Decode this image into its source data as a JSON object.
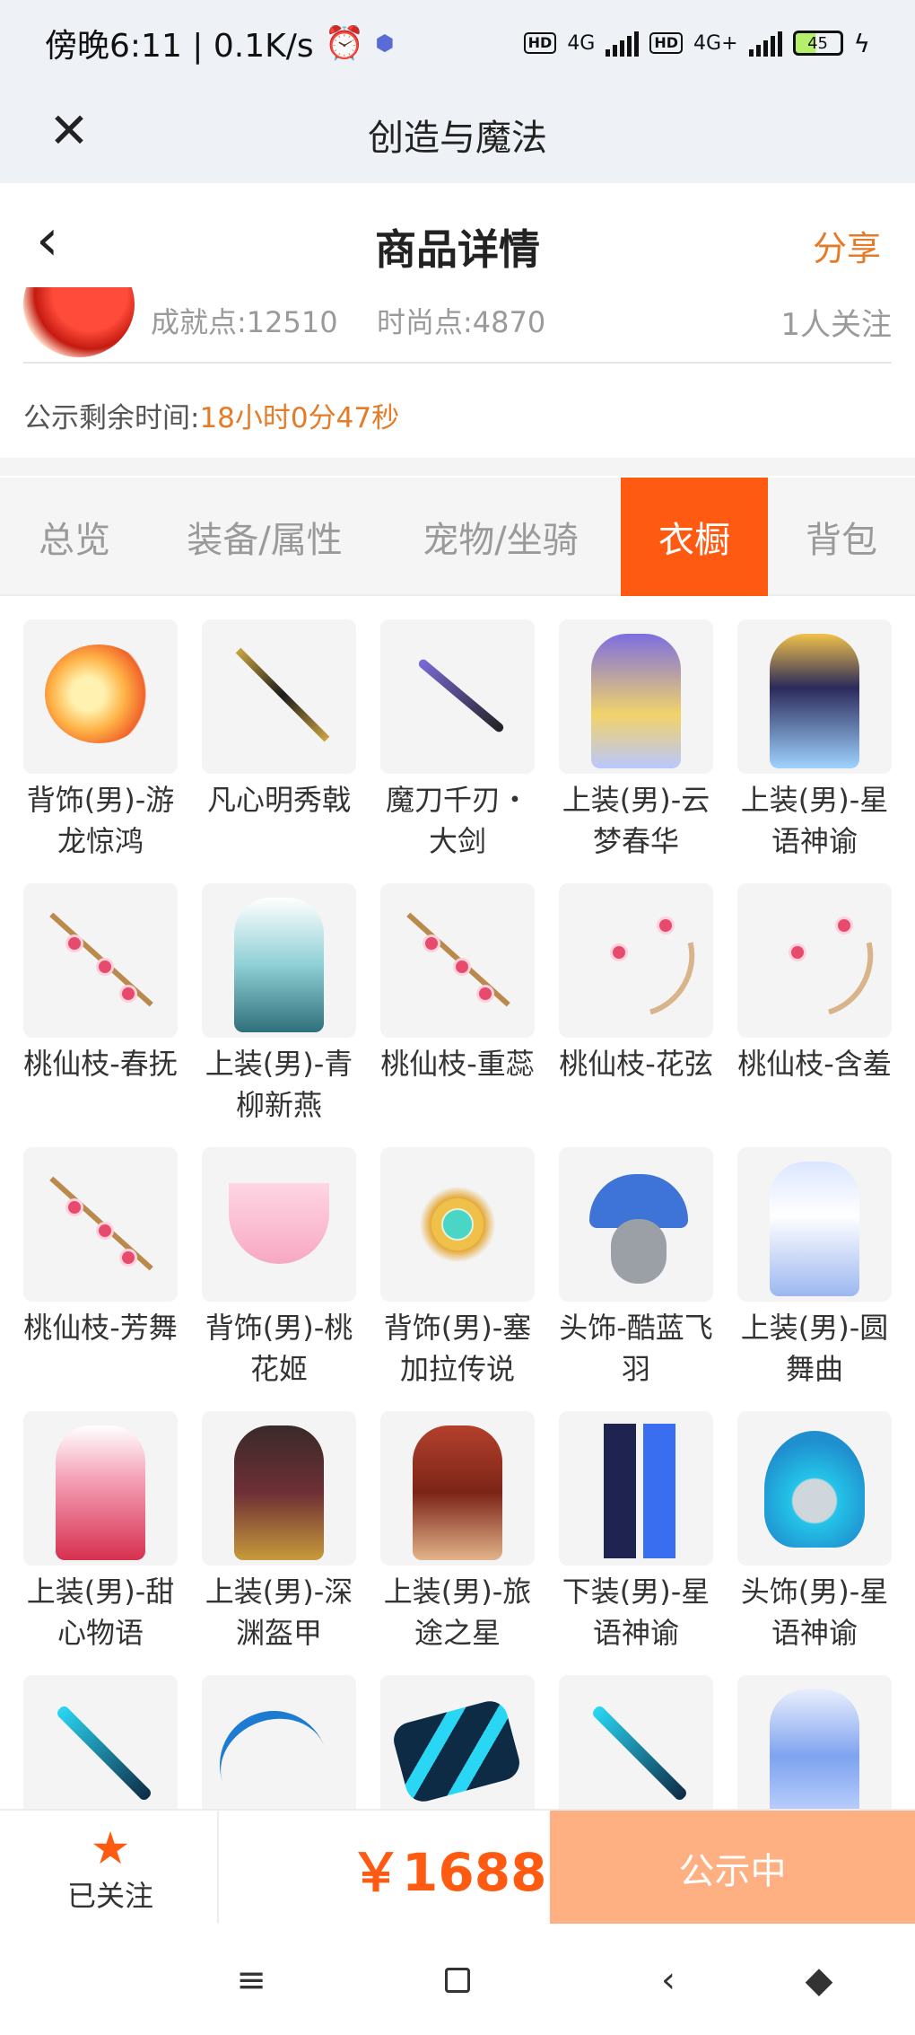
{
  "status_bar": {
    "time": "傍晚6:11 | 0.1K/s",
    "network1": "4G",
    "network2": "4G+",
    "battery": "45"
  },
  "app_bar": {
    "title": "创造与魔法"
  },
  "page_header": {
    "title": "商品详情",
    "share": "分享"
  },
  "seller": {
    "achievement": "成就点:12510",
    "fashion": "时尚点:4870",
    "followers": "1人关注"
  },
  "publicity": {
    "label": "公示剩余时间:",
    "value": "18小时0分47秒"
  },
  "tabs": [
    {
      "label": "总览",
      "active": false
    },
    {
      "label": "装备/属性",
      "active": false
    },
    {
      "label": "宠物/坐骑",
      "active": false
    },
    {
      "label": "衣橱",
      "active": true
    },
    {
      "label": "背包",
      "active": false
    }
  ],
  "wardrobe": [
    {
      "name": "背饰(男)-游龙惊鸿",
      "art": "fire"
    },
    {
      "name": "凡心明秀戟",
      "art": "spear"
    },
    {
      "name": "魔刀千刃・大剑",
      "art": "blade"
    },
    {
      "name": "上装(男)-云梦春华",
      "art": "robe-purple"
    },
    {
      "name": "上装(男)-星语神谕",
      "art": "robe-star"
    },
    {
      "name": "桃仙枝-春抚",
      "art": "branch"
    },
    {
      "name": "上装(男)-青柳新燕",
      "art": "robe-teal"
    },
    {
      "name": "桃仙枝-重蕊",
      "art": "branch"
    },
    {
      "name": "桃仙枝-花弦",
      "art": "bow"
    },
    {
      "name": "桃仙枝-含羞",
      "art": "bow"
    },
    {
      "name": "桃仙枝-芳舞",
      "art": "branch"
    },
    {
      "name": "背饰(男)-桃花姬",
      "art": "scarf"
    },
    {
      "name": "背饰(男)-塞加拉传说",
      "art": "sun"
    },
    {
      "name": "头饰-酷蓝飞羽",
      "art": "cap"
    },
    {
      "name": "上装(男)-圆舞曲",
      "art": "robe-blue"
    },
    {
      "name": "上装(男)-甜心物语",
      "art": "robe-pink"
    },
    {
      "name": "上装(男)-深渊盔甲",
      "art": "robe-dark"
    },
    {
      "name": "上装(男)-旅途之星",
      "art": "robe-red"
    },
    {
      "name": "下装(男)-星语神谕",
      "art": "pants"
    },
    {
      "name": "头饰(男)-星语神谕",
      "art": "hair"
    },
    {
      "name": "",
      "art": "cyan-blade"
    },
    {
      "name": "",
      "art": "scythe"
    },
    {
      "name": "",
      "art": "claws"
    },
    {
      "name": "",
      "art": "cyan-blade"
    },
    {
      "name": "",
      "art": "robe-ice"
    }
  ],
  "bottom_bar": {
    "favorite_label": "已关注",
    "price": "￥1688",
    "status_button": "公示中"
  },
  "colors": {
    "accent": "#ff5a12",
    "orange_text": "#e57b27",
    "status_button": "#ffb083"
  },
  "icons": {
    "close": "close-icon",
    "back": "chevron-left-icon",
    "favorite": "star-icon",
    "nav_menu": "menu-icon",
    "nav_home": "home-square-icon",
    "nav_back": "back-triangle-icon",
    "nav_assistant": "assistant-icon"
  }
}
